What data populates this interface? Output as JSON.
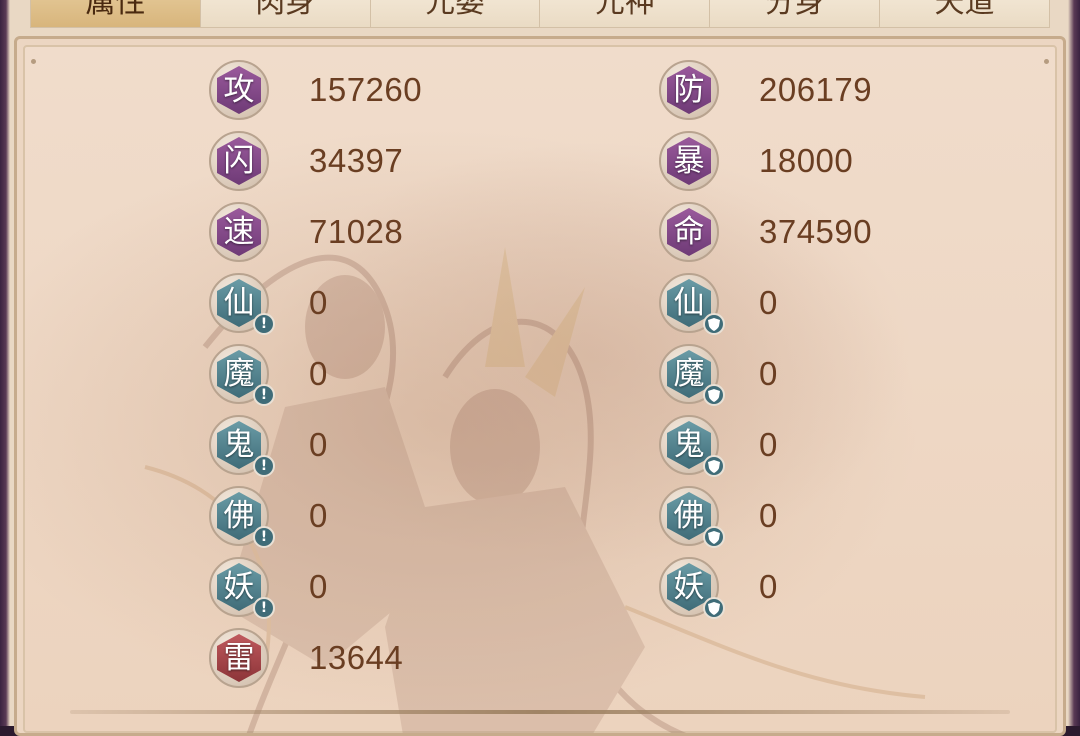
{
  "tabs": [
    "属性",
    "肉身",
    "元婴",
    "元神",
    "分身",
    "天道"
  ],
  "active_tab": 0,
  "left_stats": [
    {
      "glyph": "攻",
      "value": "157260",
      "color": "purple",
      "mark": ""
    },
    {
      "glyph": "闪",
      "value": "34397",
      "color": "purple",
      "mark": ""
    },
    {
      "glyph": "速",
      "value": "71028",
      "color": "purple",
      "mark": ""
    },
    {
      "glyph": "仙",
      "value": "0",
      "color": "teal",
      "mark": "!"
    },
    {
      "glyph": "魔",
      "value": "0",
      "color": "teal",
      "mark": "!"
    },
    {
      "glyph": "鬼",
      "value": "0",
      "color": "teal",
      "mark": "!"
    },
    {
      "glyph": "佛",
      "value": "0",
      "color": "teal",
      "mark": "!"
    },
    {
      "glyph": "妖",
      "value": "0",
      "color": "teal",
      "mark": "!"
    },
    {
      "glyph": "雷",
      "value": "13644",
      "color": "red",
      "mark": ""
    }
  ],
  "right_stats": [
    {
      "glyph": "防",
      "value": "206179",
      "color": "purple",
      "mark": ""
    },
    {
      "glyph": "暴",
      "value": "18000",
      "color": "purple",
      "mark": ""
    },
    {
      "glyph": "命",
      "value": "374590",
      "color": "purple",
      "mark": ""
    },
    {
      "glyph": "仙",
      "value": "0",
      "color": "teal",
      "mark": "shield"
    },
    {
      "glyph": "魔",
      "value": "0",
      "color": "teal",
      "mark": "shield"
    },
    {
      "glyph": "鬼",
      "value": "0",
      "color": "teal",
      "mark": "shield"
    },
    {
      "glyph": "佛",
      "value": "0",
      "color": "teal",
      "mark": "shield"
    },
    {
      "glyph": "妖",
      "value": "0",
      "color": "teal",
      "mark": "shield"
    }
  ],
  "colors": {
    "purple": "#7e4686",
    "teal": "#4f808c",
    "red": "#a8444a",
    "value_text": "#6a3e22"
  }
}
